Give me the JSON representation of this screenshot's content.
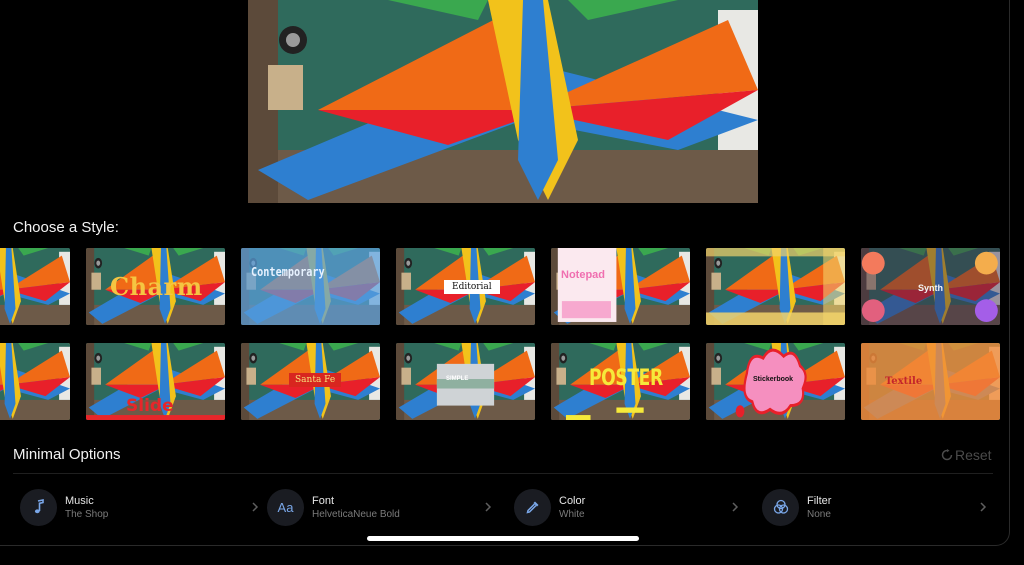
{
  "styles": {
    "heading": "Choose a Style:",
    "row1": [
      {
        "label": ""
      },
      {
        "label": "Charm"
      },
      {
        "label": "Contemporary"
      },
      {
        "label": "Editorial"
      },
      {
        "label": "Notepad"
      },
      {
        "label": ""
      },
      {
        "label": "Synth"
      }
    ],
    "row2": [
      {
        "label": "",
        "selected": true
      },
      {
        "label": "Slide"
      },
      {
        "label": "Santa Fe"
      },
      {
        "label": "SIMPLE"
      },
      {
        "label": "POSTER"
      },
      {
        "label": "Stickerbook"
      },
      {
        "label": "Textile"
      }
    ]
  },
  "options": {
    "heading": "Minimal Options",
    "reset_label": "Reset",
    "items": [
      {
        "title": "Music",
        "value": "The Shop",
        "icon": "music-note-icon"
      },
      {
        "title": "Font",
        "value": "HelveticaNeue Bold",
        "icon": "font-aa-icon",
        "icon_text": "Aa"
      },
      {
        "title": "Color",
        "value": "White",
        "icon": "eyedropper-icon"
      },
      {
        "title": "Filter",
        "value": "None",
        "icon": "filter-circles-icon"
      }
    ]
  },
  "colors": {
    "accent_selected": "#f0b429",
    "icon_blue": "#7aa7e8",
    "background": "#000000"
  }
}
